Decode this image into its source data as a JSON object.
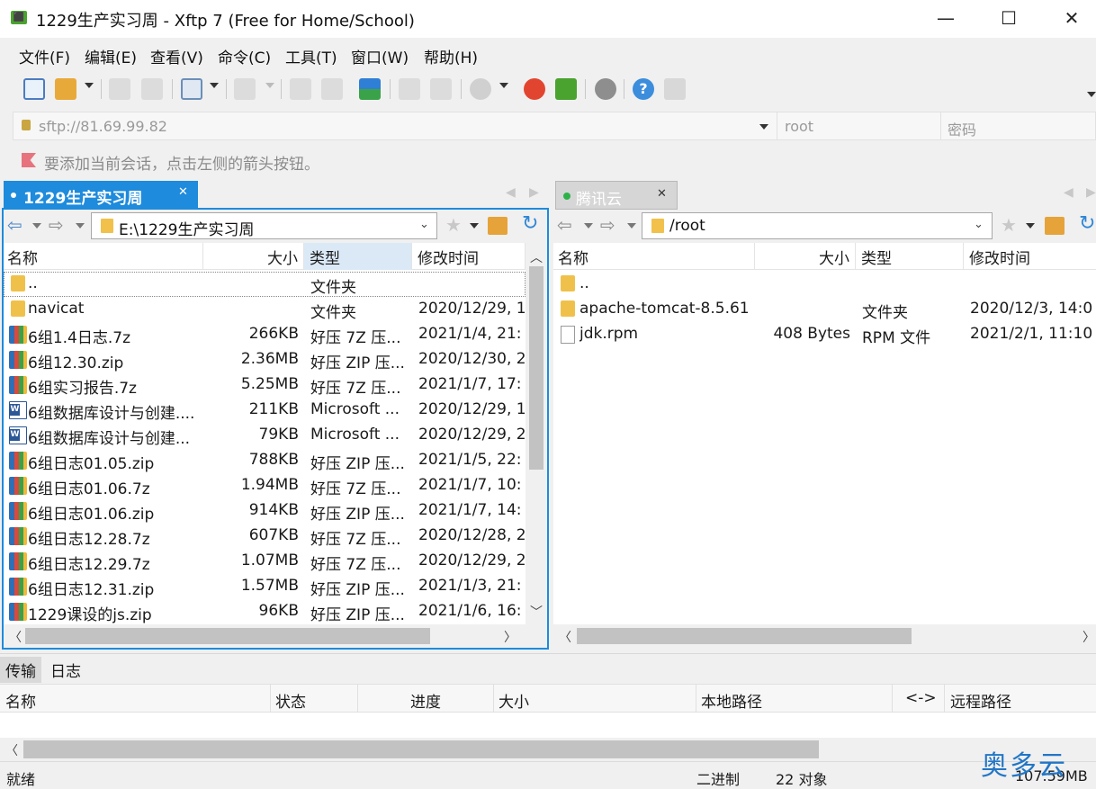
{
  "window": {
    "title": "1229生产实习周 - Xftp 7 (Free for Home/School)",
    "minimize": "—",
    "maximize": "☐",
    "close": "✕"
  },
  "menu": [
    "文件(F)",
    "编辑(E)",
    "查看(V)",
    "命令(C)",
    "工具(T)",
    "窗口(W)",
    "帮助(H)"
  ],
  "address": {
    "host_placeholder": "sftp://81.69.99.82",
    "user_placeholder": "root",
    "password_placeholder": "密码"
  },
  "hint": "要添加当前会话，点击左侧的箭头按钮。",
  "left_pane": {
    "tab": "1229生产实习周",
    "path": "E:\\1229生产实习周",
    "columns": [
      "名称",
      "大小",
      "类型",
      "修改时间"
    ],
    "rows": [
      {
        "icon": "folder-icon",
        "name": "..",
        "size": "",
        "type": "文件夹",
        "modified": ""
      },
      {
        "icon": "folder-icon",
        "name": "navicat",
        "size": "",
        "type": "文件夹",
        "modified": "2020/12/29, 1"
      },
      {
        "icon": "archive-icon",
        "name": "6组1.4日志.7z",
        "size": "266KB",
        "type": "好压 7Z 压...",
        "modified": "2021/1/4, 21:"
      },
      {
        "icon": "archive-icon",
        "name": "6组12.30.zip",
        "size": "2.36MB",
        "type": "好压 ZIP 压...",
        "modified": "2020/12/30, 2"
      },
      {
        "icon": "archive-icon",
        "name": "6组实习报告.7z",
        "size": "5.25MB",
        "type": "好压 7Z 压...",
        "modified": "2021/1/7, 17:"
      },
      {
        "icon": "word-doc-icon",
        "name": "6组数据库设计与创建....",
        "size": "211KB",
        "type": "Microsoft ...",
        "modified": "2020/12/29, 1"
      },
      {
        "icon": "word-doc-icon",
        "name": "6组数据库设计与创建...",
        "size": "79KB",
        "type": "Microsoft ...",
        "modified": "2020/12/29, 2"
      },
      {
        "icon": "archive-icon",
        "name": "6组日志01.05.zip",
        "size": "788KB",
        "type": "好压 ZIP 压...",
        "modified": "2021/1/5, 22:"
      },
      {
        "icon": "archive-icon",
        "name": "6组日志01.06.7z",
        "size": "1.94MB",
        "type": "好压 7Z 压...",
        "modified": "2021/1/7, 10:"
      },
      {
        "icon": "archive-icon",
        "name": "6组日志01.06.zip",
        "size": "914KB",
        "type": "好压 ZIP 压...",
        "modified": "2021/1/7, 14:"
      },
      {
        "icon": "archive-icon",
        "name": "6组日志12.28.7z",
        "size": "607KB",
        "type": "好压 7Z 压...",
        "modified": "2020/12/28, 2"
      },
      {
        "icon": "archive-icon",
        "name": "6组日志12.29.7z",
        "size": "1.07MB",
        "type": "好压 7Z 压...",
        "modified": "2020/12/29, 2"
      },
      {
        "icon": "archive-icon",
        "name": "6组日志12.31.zip",
        "size": "1.57MB",
        "type": "好压 ZIP 压...",
        "modified": "2021/1/3, 21:"
      },
      {
        "icon": "archive-icon",
        "name": "1229课设的js.zip",
        "size": "96KB",
        "type": "好压 ZIP 压...",
        "modified": "2021/1/6, 16:"
      }
    ]
  },
  "right_pane": {
    "tab": "腾讯云",
    "path": "/root",
    "columns": [
      "名称",
      "大小",
      "类型",
      "修改时间"
    ],
    "rows": [
      {
        "icon": "folder-icon",
        "name": "..",
        "size": "",
        "type": "",
        "modified": ""
      },
      {
        "icon": "folder-icon",
        "name": "apache-tomcat-8.5.61",
        "size": "",
        "type": "文件夹",
        "modified": "2020/12/3, 14:0"
      },
      {
        "icon": "file-icon",
        "name": "jdk.rpm",
        "size": "408 Bytes",
        "type": "RPM 文件",
        "modified": "2021/2/1, 11:10"
      }
    ]
  },
  "transfer": {
    "tabs": [
      "传输",
      "日志"
    ],
    "columns": [
      "名称",
      "状态",
      "进度",
      "大小",
      "本地路径",
      "<->",
      "远程路径"
    ]
  },
  "status": {
    "ready": "就绪",
    "mode": "二进制",
    "objects": "22 对象",
    "size": "107.59MB"
  },
  "watermark": "奥多云",
  "colors": {
    "accent": "#1e8bdc",
    "connected_dot": "#2db24a"
  }
}
